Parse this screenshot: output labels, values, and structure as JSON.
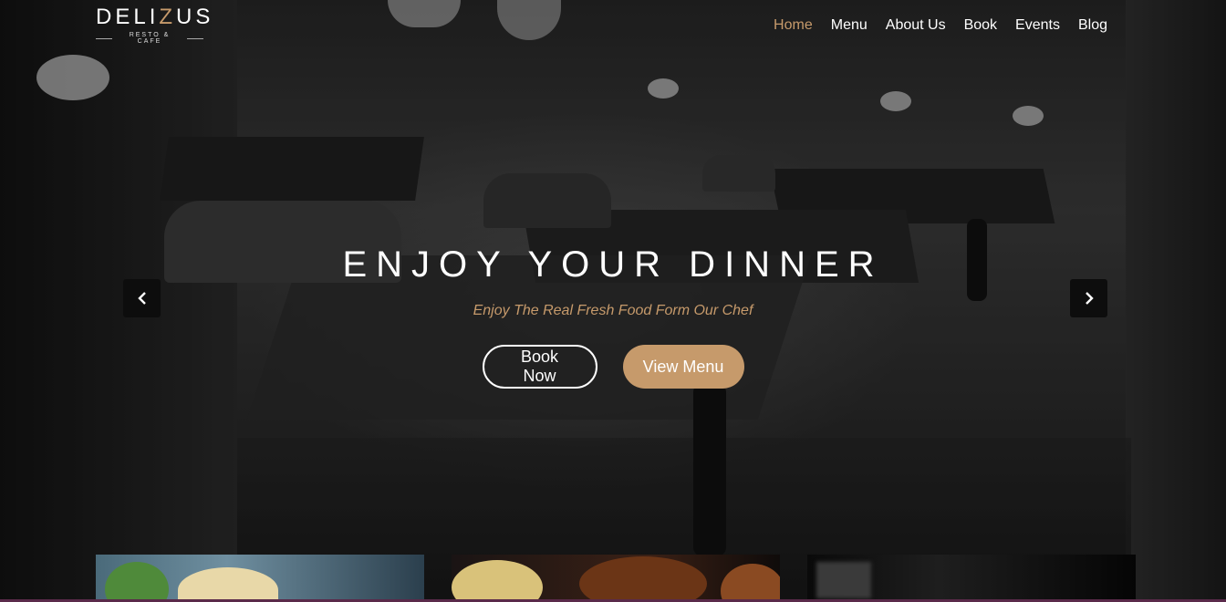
{
  "brand": {
    "name_start": "DELI",
    "name_accent": "Z",
    "name_end": "US",
    "tagline": "RESTO & CAFE"
  },
  "nav": {
    "items": [
      {
        "label": "Home",
        "active": true
      },
      {
        "label": "Menu",
        "active": false
      },
      {
        "label": "About Us",
        "active": false
      },
      {
        "label": "Book",
        "active": false
      },
      {
        "label": "Events",
        "active": false
      },
      {
        "label": "Blog",
        "active": false
      }
    ]
  },
  "hero": {
    "title": "ENJOY YOUR DINNER",
    "subtitle": "Enjoy The Real Fresh Food Form Our Chef",
    "book_button": "Book Now",
    "menu_button": "View Menu"
  },
  "carousel": {
    "prev_icon": "chevron-left-icon",
    "next_icon": "chevron-right-icon"
  },
  "colors": {
    "accent": "#c69a6b",
    "text": "#ffffff",
    "arrow_bg": "#0d0d0d"
  }
}
